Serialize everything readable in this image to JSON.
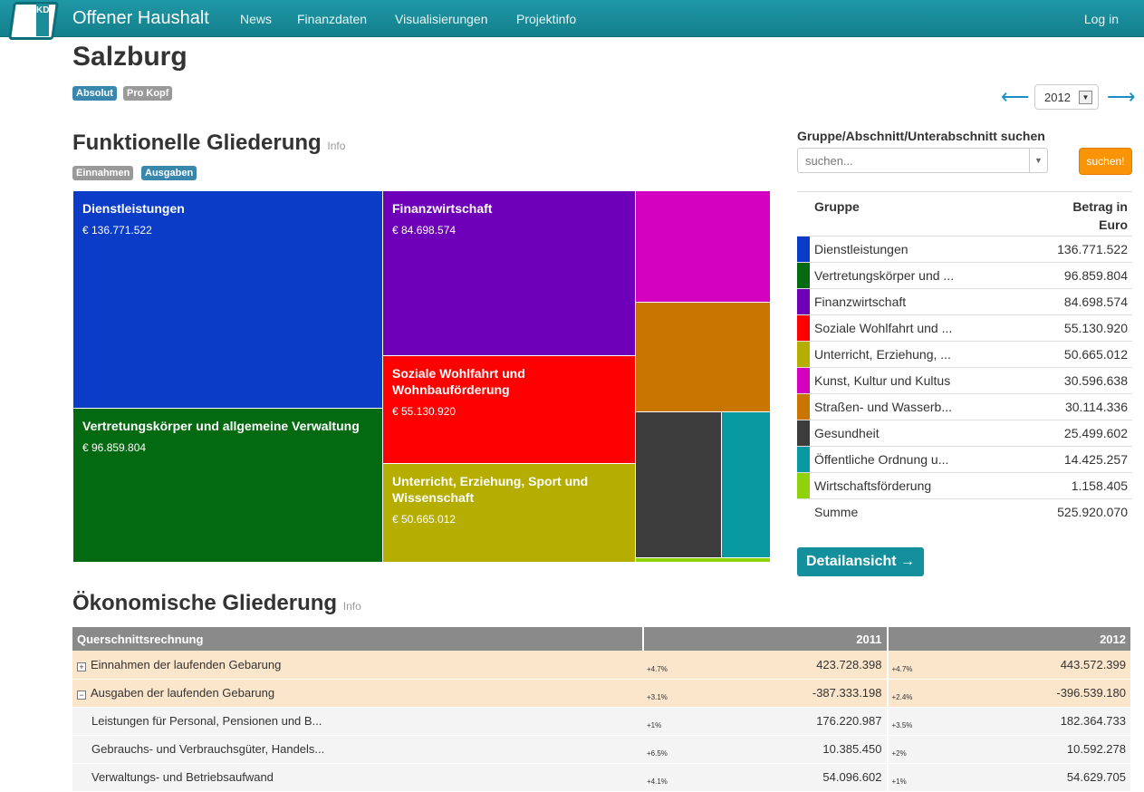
{
  "nav": {
    "logo_letters": "KDZ",
    "brand": "Offener Haushalt",
    "items": [
      "News",
      "Finanzdaten",
      "Visualisierungen",
      "Projektinfo"
    ],
    "login": "Log in"
  },
  "page": {
    "title": "Salzburg",
    "mode_tabs": [
      "Absolut",
      "Pro Kopf"
    ],
    "year": "2012",
    "prev_icon": "⟵",
    "next_icon": "⟶"
  },
  "functional": {
    "heading": "Funktionelle Gliederung",
    "info": "Info",
    "tabs": [
      "Einnahmen",
      "Ausgaben"
    ],
    "colors": {
      "Dienstleistungen": "#0b3cc8",
      "Vertretung": "#046a12",
      "Finanzwirtschaft": "#6f00b9",
      "Soziale": "#fe0000",
      "Unterricht": "#b5ad00",
      "Kunst": "#d400c0",
      "Strassen": "#c87600",
      "Gesundheit": "#3c3c3c",
      "Ordnung": "#0898a0",
      "Wirtschaft": "#8fd10a"
    },
    "tiles": [
      {
        "name": "Dienstleistungen",
        "value": "€ 136.771.522"
      },
      {
        "name": "Vertretungskörper und allgemeine Verwaltung",
        "value": "€ 96.859.804"
      },
      {
        "name": "Finanzwirtschaft",
        "value": "€ 84.698.574"
      },
      {
        "name": "Soziale Wohlfahrt und Wohnbauförderung",
        "value": "€ 55.130.920"
      },
      {
        "name": "Unterricht, Erziehung, Sport und Wissenschaft",
        "value": "€ 50.665.012"
      }
    ]
  },
  "search": {
    "label": "Gruppe/Abschnitt/Unterabschnitt suchen",
    "placeholder": "suchen...",
    "button": "suchen!"
  },
  "group_table": {
    "col_group": "Gruppe",
    "col_amount_1": "Betrag in",
    "col_amount_2": "Euro",
    "rows": [
      {
        "color": "#0b3cc8",
        "name": "Dienstleistungen",
        "value": "136.771.522"
      },
      {
        "color": "#046a12",
        "name": "Vertretungskörper und ...",
        "value": "96.859.804"
      },
      {
        "color": "#6f00b9",
        "name": "Finanzwirtschaft",
        "value": "84.698.574"
      },
      {
        "color": "#fe0000",
        "name": "Soziale Wohlfahrt und ...",
        "value": "55.130.920"
      },
      {
        "color": "#b5ad00",
        "name": "Unterricht, Erziehung, ...",
        "value": "50.665.012"
      },
      {
        "color": "#d400c0",
        "name": "Kunst, Kultur und Kultus",
        "value": "30.596.638"
      },
      {
        "color": "#c87600",
        "name": "Straßen- und Wasserb...",
        "value": "30.114.336"
      },
      {
        "color": "#3c3c3c",
        "name": "Gesundheit",
        "value": "25.499.602"
      },
      {
        "color": "#0898a0",
        "name": "Öffentliche Ordnung u...",
        "value": "14.425.257"
      },
      {
        "color": "#8fd10a",
        "name": "Wirtschaftsförderung",
        "value": "1.158.405"
      }
    ],
    "sum_label": "Summe",
    "sum_value": "525.920.070"
  },
  "detail_button": "Detailansicht →",
  "economic": {
    "heading": "Ökonomische Gliederung",
    "info": "Info",
    "col_label": "Querschnittsrechnung",
    "col_2011": "2011",
    "col_2012": "2012",
    "rows": [
      {
        "level": 1,
        "expander": "+",
        "label": "Einnahmen der laufenden Gebarung",
        "pct2011": "+4.7%",
        "v2011": "423.728.398",
        "pct2012": "+4.7%",
        "v2012": "443.572.399"
      },
      {
        "level": 1,
        "expander": "−",
        "label": "Ausgaben der laufenden Gebarung",
        "pct2011": "+3.1%",
        "v2011": "-387.333.198",
        "pct2012": "+2.4%",
        "v2012": "-396.539.180"
      },
      {
        "level": 2,
        "expander": "",
        "label": "Leistungen für Personal, Pensionen und B...",
        "pct2011": "+1%",
        "v2011": "176.220.987",
        "pct2012": "+3.5%",
        "v2012": "182.364.733"
      },
      {
        "level": 2,
        "expander": "",
        "label": "Gebrauchs- und Verbrauchsgüter, Handels...",
        "pct2011": "+6.5%",
        "v2011": "10.385.450",
        "pct2012": "+2%",
        "v2012": "10.592.278"
      },
      {
        "level": 2,
        "expander": "",
        "label": "Verwaltungs- und Betriebsaufwand",
        "pct2011": "+4.1%",
        "v2011": "54.096.602",
        "pct2012": "+1%",
        "v2012": "54.629.705"
      }
    ]
  }
}
